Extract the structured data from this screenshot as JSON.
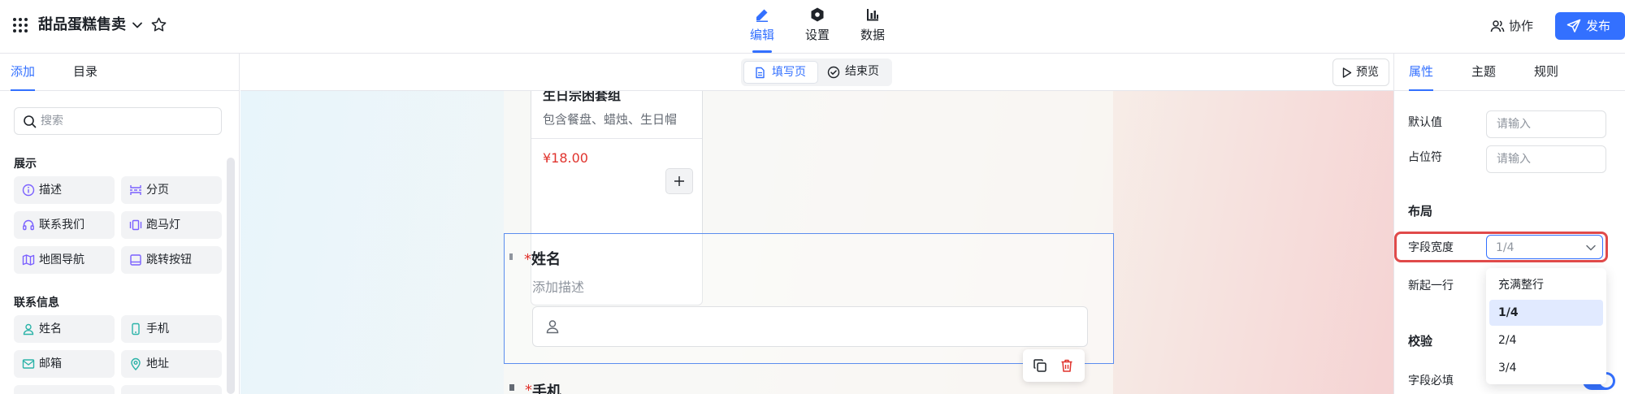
{
  "app": {
    "title": "甜品蛋糕售卖"
  },
  "top_nav": {
    "tabs": [
      {
        "label": "编辑",
        "active": true
      },
      {
        "label": "设置",
        "active": false
      },
      {
        "label": "数据",
        "active": false
      }
    ],
    "collab_label": "协作",
    "publish_label": "发布"
  },
  "left_panel": {
    "tabs": [
      {
        "label": "添加",
        "active": true
      },
      {
        "label": "目录",
        "active": false
      }
    ],
    "search_placeholder": "搜索",
    "groups": [
      {
        "title": "展示",
        "items": [
          {
            "label": "描述",
            "icon": "info-circle-icon"
          },
          {
            "label": "分页",
            "icon": "page-break-icon"
          },
          {
            "label": "联系我们",
            "icon": "headset-icon"
          },
          {
            "label": "跑马灯",
            "icon": "carousel-icon"
          },
          {
            "label": "地图导航",
            "icon": "map-icon"
          },
          {
            "label": "跳转按钮",
            "icon": "jump-button-icon"
          }
        ]
      },
      {
        "title": "联系信息",
        "items": [
          {
            "label": "姓名",
            "icon": "person-icon"
          },
          {
            "label": "手机",
            "icon": "phone-icon"
          },
          {
            "label": "邮箱",
            "icon": "mail-icon"
          },
          {
            "label": "地址",
            "icon": "location-icon"
          }
        ]
      }
    ]
  },
  "center_bar": {
    "page_tabs": [
      {
        "label": "填写页",
        "active": true
      },
      {
        "label": "结束页",
        "active": false
      }
    ],
    "preview_label": "预览"
  },
  "canvas": {
    "product": {
      "name": "生日宗困套组",
      "desc": "包含餐盘、蜡烛、生日帽",
      "price": "¥18.00"
    },
    "name_field": {
      "required_mark": "*",
      "label": "姓名",
      "description": "添加描述"
    },
    "next_field": {
      "required_mark": "*",
      "label": "手机"
    }
  },
  "right_panel": {
    "tabs": [
      {
        "label": "属性",
        "active": true
      },
      {
        "label": "主题",
        "active": false
      },
      {
        "label": "规则",
        "active": false
      }
    ],
    "default_value": {
      "label": "默认值",
      "placeholder": "请输入"
    },
    "placeholder_text": {
      "label": "占位符",
      "placeholder": "请输入"
    },
    "layout_heading": "布局",
    "field_width": {
      "label": "字段宽度",
      "value": "1/4",
      "options": [
        "充满整行",
        "1/4",
        "2/4",
        "3/4"
      ],
      "selected": "1/4"
    },
    "new_line_label": "新起一行",
    "validation_heading": "校验",
    "required_label": "字段必填",
    "required_on": true
  },
  "colors": {
    "accent": "#3370ff",
    "price": "#e0332d",
    "highlight": "#e04a4a",
    "selected_option_bg": "#e1eaff"
  }
}
